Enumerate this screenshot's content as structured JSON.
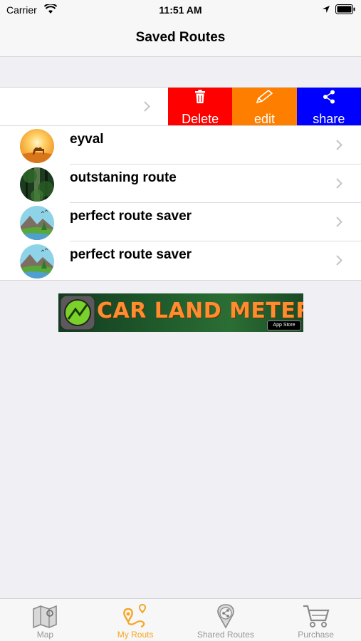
{
  "status_bar": {
    "carrier": "Carrier",
    "time": "11:51 AM"
  },
  "nav": {
    "title": "Saved Routes"
  },
  "swipe_actions": [
    {
      "label": "Delete",
      "icon": "trash-icon",
      "color": "#fe0000"
    },
    {
      "label": "edit",
      "icon": "pencil-icon",
      "color": "#fe7f00"
    },
    {
      "label": "share",
      "icon": "share-icon",
      "color": "#0000fe"
    }
  ],
  "routes": [
    {
      "name": "eyval",
      "avatar": "desert-camel-icon"
    },
    {
      "name": "outstaning route",
      "avatar": "forest-icon"
    },
    {
      "name": "perfect route saver",
      "avatar": "mountain-landscape-icon"
    },
    {
      "name": "perfect route saver",
      "avatar": "mountain-landscape-icon"
    }
  ],
  "ad": {
    "text": "CAR LAND METER",
    "badge": "App Store"
  },
  "tabs": [
    {
      "label": "Map",
      "icon": "map-icon",
      "active": false
    },
    {
      "label": "My Routs",
      "icon": "route-pins-icon",
      "active": true
    },
    {
      "label": "Shared Routes",
      "icon": "shared-pin-icon",
      "active": false
    },
    {
      "label": "Purchase",
      "icon": "cart-icon",
      "active": false
    }
  ],
  "colors": {
    "accent": "#f5a623",
    "inactive": "#999999"
  }
}
